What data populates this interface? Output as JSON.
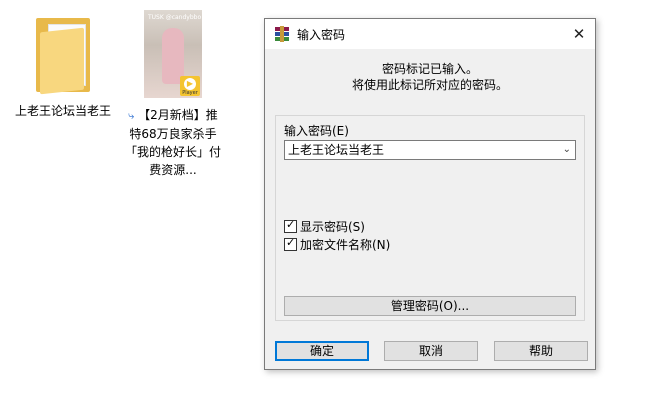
{
  "desktop": {
    "folder": {
      "label": "上老王论坛当老王"
    },
    "video": {
      "label": "【2月新档】推特68万良家杀手「我的枪好长」付费资源...",
      "badge": "Player",
      "caption": "TUSK @candybbo"
    }
  },
  "dialog": {
    "title": "输入密码",
    "info_line1": "密码标记已输入。",
    "info_line2": "将使用此标记所对应的密码。",
    "password_label": "输入密码(E)",
    "password_value": "上老王论坛当老王",
    "show_password": {
      "label": "显示密码(S)",
      "checked": true
    },
    "encrypt_names": {
      "label": "加密文件名称(N)",
      "checked": true
    },
    "manage_button": "管理密码(O)...",
    "ok_button": "确定",
    "cancel_button": "取消",
    "help_button": "帮助"
  },
  "colors": {
    "accent": "#0078d7",
    "folder": "#f8d77f",
    "dialog_bg": "#f0f0f0"
  }
}
